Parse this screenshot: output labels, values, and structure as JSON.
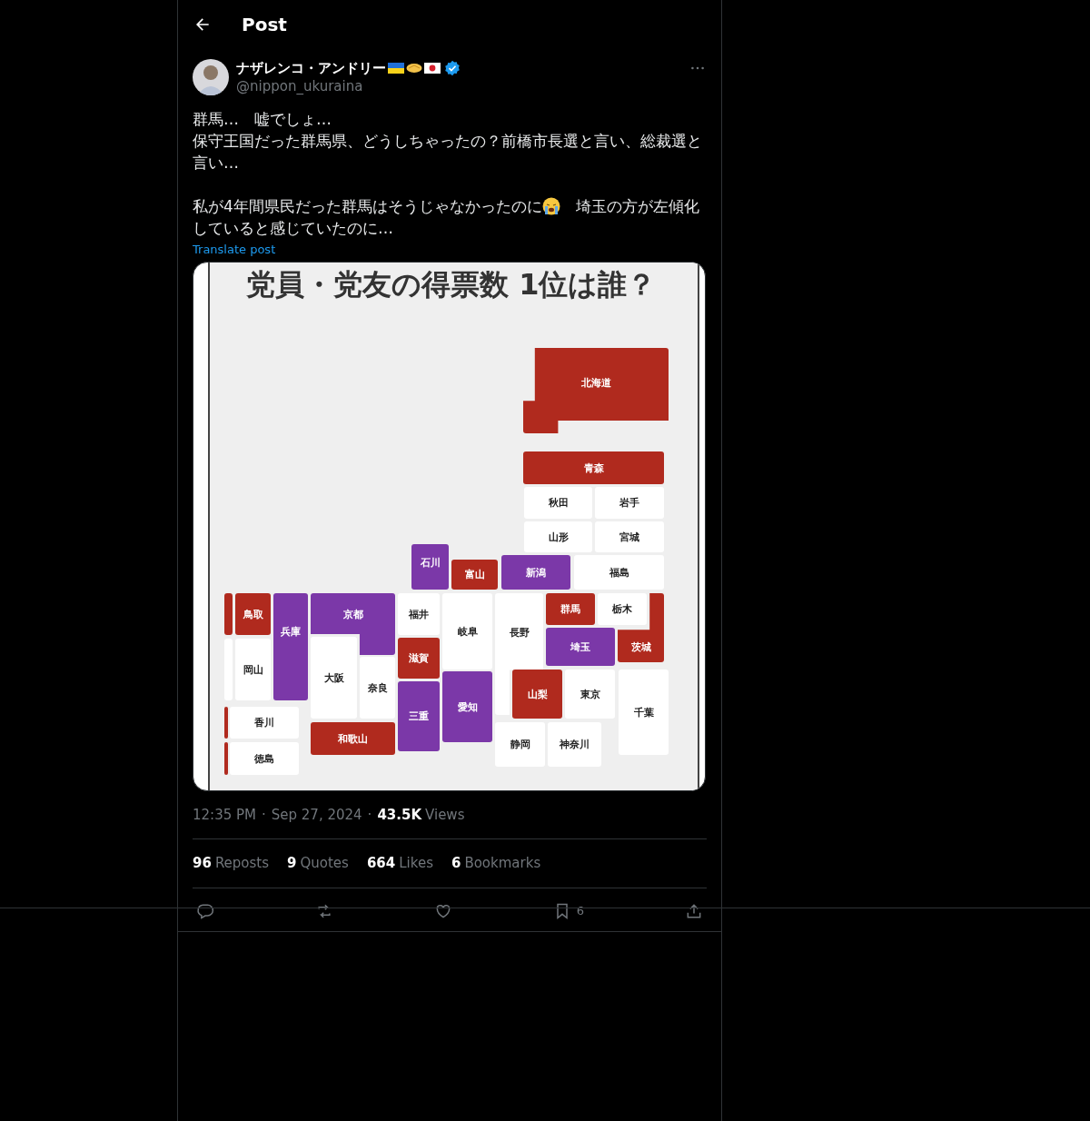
{
  "header": {
    "title": "Post"
  },
  "author": {
    "name": "ナザレンコ・アンドリー",
    "handle": "@nippon_ukuraina",
    "verified": true
  },
  "body": {
    "lines": [
      "群馬…　嘘でしょ…",
      "保守王国だった群馬県、どうしちゃったの？前橋市長選と言い、総裁選と言い…"
    ],
    "paragraph_2_before_emoji": "私が4年間県民だった群馬はそうじゃなかったのに",
    "paragraph_2_after_emoji": "　埼玉の方が左傾化",
    "paragraph_2_last_line": "していると感じていたのに…",
    "translate_link": "Translate post"
  },
  "image": {
    "title": "党員・党友の得票数 1位は誰？",
    "tiles": [
      {
        "label": "北海道",
        "color": "#b02a1e"
      },
      {
        "label": "青森",
        "color": "#b02a1e"
      },
      {
        "label": "秋田",
        "color": "#ffffff"
      },
      {
        "label": "岩手",
        "color": "#ffffff"
      },
      {
        "label": "山形",
        "color": "#ffffff"
      },
      {
        "label": "宮城",
        "color": "#ffffff"
      },
      {
        "label": "石川",
        "color": "#7b38a8"
      },
      {
        "label": "富山",
        "color": "#b02a1e"
      },
      {
        "label": "新潟",
        "color": "#7b38a8"
      },
      {
        "label": "福島",
        "color": "#ffffff"
      },
      {
        "color": "#b02a1e"
      },
      {
        "label": "鳥取",
        "color": "#b02a1e"
      },
      {
        "label": "兵庫",
        "color": "#7b38a8"
      },
      {
        "label": "京都",
        "color": "#7b38a8"
      },
      {
        "label": "福井",
        "color": "#ffffff"
      },
      {
        "label": "岐阜",
        "color": "#ffffff"
      },
      {
        "label": "長野",
        "color": "#ffffff"
      },
      {
        "label": "群馬",
        "color": "#b02a1e"
      },
      {
        "label": "栃木",
        "color": "#ffffff"
      },
      {
        "label": "茨城",
        "color": "#b02a1e"
      },
      {
        "color": "#ffffff"
      },
      {
        "label": "岡山",
        "color": "#ffffff"
      },
      {
        "label": "大阪",
        "color": "#ffffff"
      },
      {
        "label": "奈良",
        "color": "#ffffff"
      },
      {
        "label": "滋賀",
        "color": "#b02a1e"
      },
      {
        "label": "埼玉",
        "color": "#7b38a8"
      },
      {
        "label": "愛知",
        "color": "#7b38a8"
      },
      {
        "label": "三重",
        "color": "#7b38a8"
      },
      {
        "label": "山梨",
        "color": "#b02a1e"
      },
      {
        "label": "東京",
        "color": "#ffffff"
      },
      {
        "label": "千葉",
        "color": "#ffffff"
      },
      {
        "color": "#b02a1e"
      },
      {
        "label": "香川",
        "color": "#ffffff"
      },
      {
        "color": "#b02a1e"
      },
      {
        "label": "徳島",
        "color": "#ffffff"
      },
      {
        "label": "和歌山",
        "color": "#b02a1e"
      },
      {
        "label": "静岡",
        "color": "#ffffff"
      },
      {
        "label": "神奈川",
        "color": "#ffffff"
      }
    ]
  },
  "meta": {
    "separators": [
      "·",
      "·"
    ],
    "time": "12:35 PM",
    "date": "Sep 27, 2024",
    "views_count": "43.5K",
    "views_label": "Views"
  },
  "stats": [
    {
      "count": "96",
      "label": "Reposts"
    },
    {
      "count": "9",
      "label": "Quotes"
    },
    {
      "count": "664",
      "label": "Likes"
    },
    {
      "count": "6",
      "label": "Bookmarks"
    }
  ],
  "actions": [
    {
      "kind": "reply"
    },
    {
      "kind": "repost"
    },
    {
      "kind": "like"
    },
    {
      "kind": "bookmark",
      "count": "6"
    },
    {
      "kind": "share"
    }
  ]
}
